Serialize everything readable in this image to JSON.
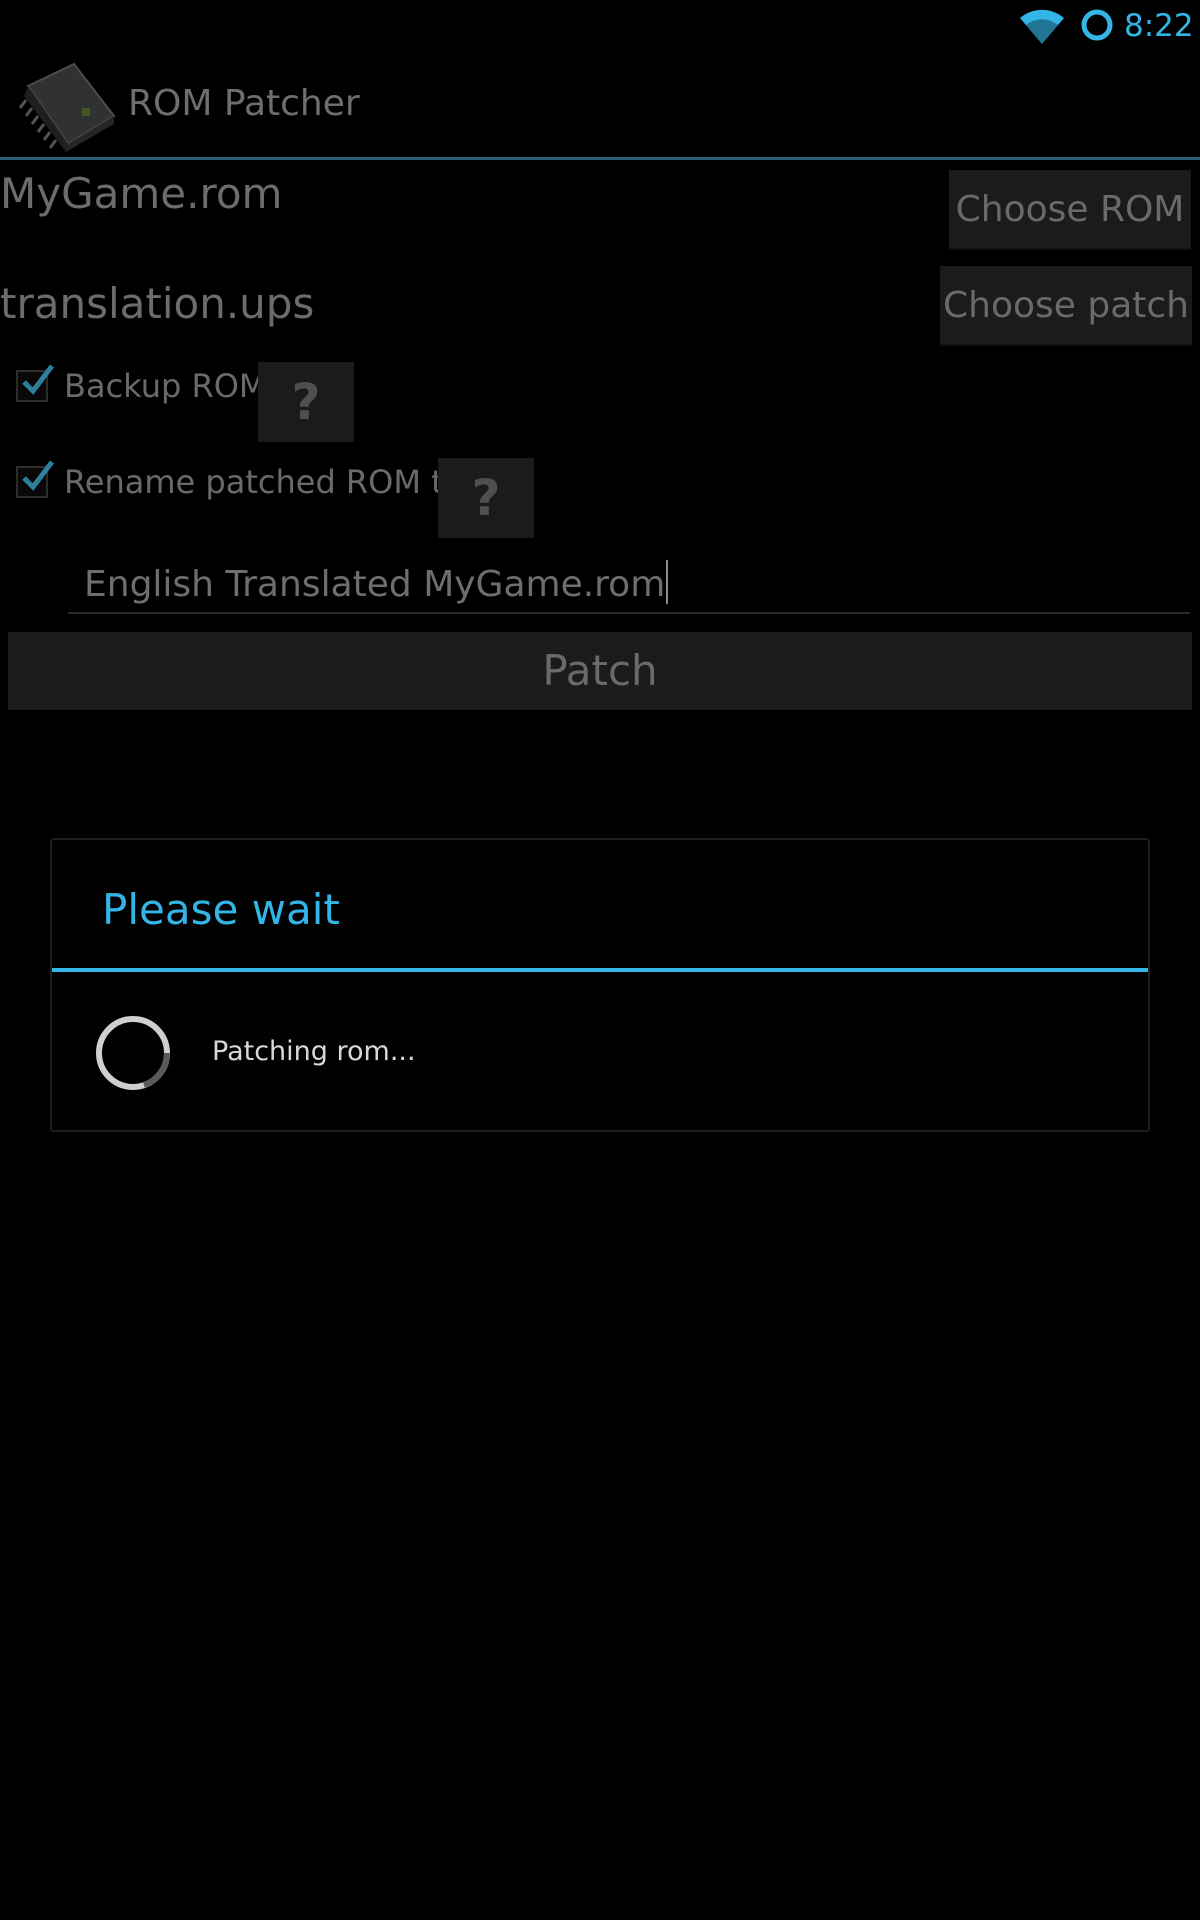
{
  "status_bar": {
    "time": "8:22",
    "icons": [
      "wifi-icon",
      "sync-icon"
    ],
    "accent_color": "#33b5e5"
  },
  "action_bar": {
    "title": "ROM Patcher",
    "icon": "chip-app-icon"
  },
  "form": {
    "rom_file": "MyGame.rom",
    "choose_rom_label": "Choose ROM",
    "patch_file": "translation.ups",
    "choose_patch_label": "Choose patch",
    "backup": {
      "label": "Backup ROM",
      "checked": true,
      "help_label": "?"
    },
    "rename": {
      "label": "Rename patched ROM to:",
      "checked": true,
      "help_label": "?"
    },
    "rename_value": "English Translated MyGame.rom",
    "patch_button_label": "Patch"
  },
  "dialog": {
    "title": "Please wait",
    "message": "Patching rom...",
    "accent_color": "#33b5e5"
  }
}
